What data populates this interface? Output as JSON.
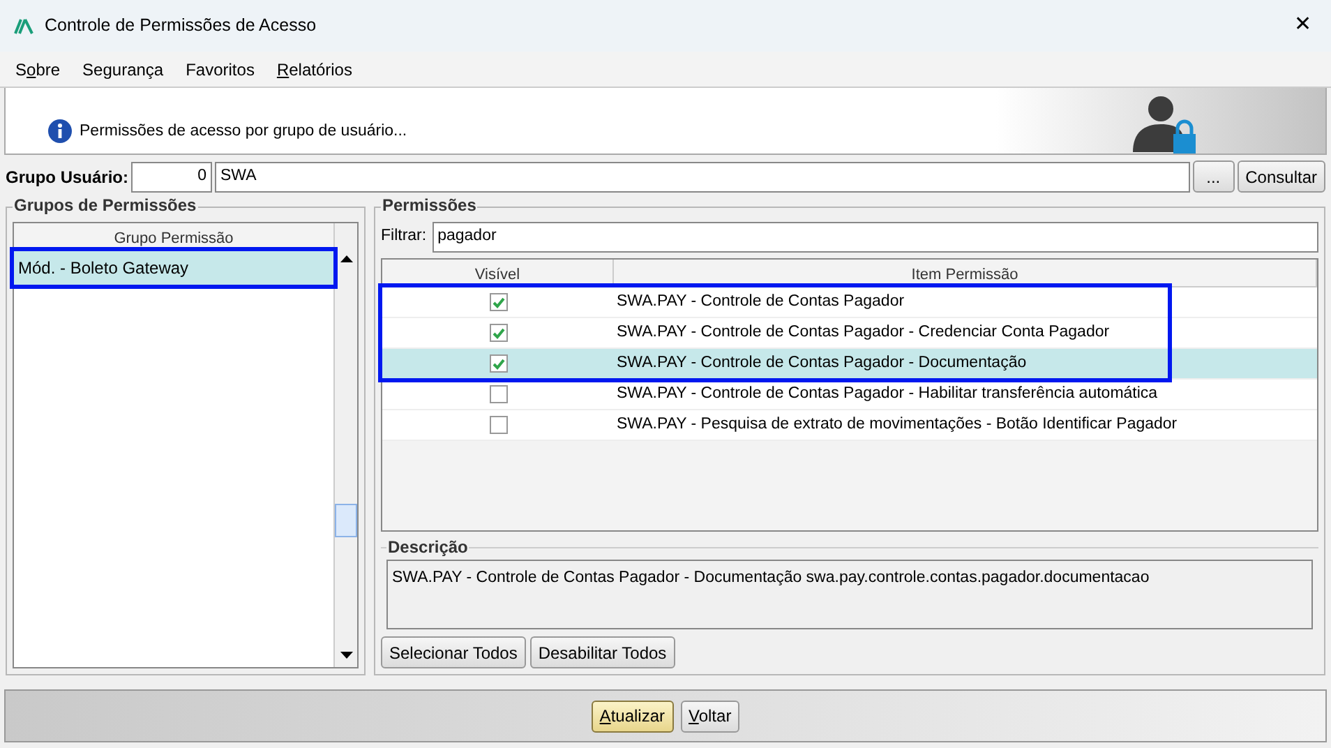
{
  "window": {
    "title": "Controle de Permissões de Acesso",
    "close": "✕"
  },
  "menu": [
    {
      "pre": "S",
      "key": "o",
      "post": "bre"
    },
    {
      "pre": "Segurança"
    },
    {
      "pre": "Favoritos"
    },
    {
      "key": "R",
      "post": "elatórios"
    }
  ],
  "banner": {
    "text": "Permissões de acesso por grupo de usuário..."
  },
  "user_group": {
    "label": "Grupo Usuário:",
    "code": "0",
    "name": "SWA",
    "browse": "...",
    "query": "Consultar"
  },
  "groups": {
    "title": "Grupos de Permissões",
    "column": "Grupo Permissão",
    "rows": [
      {
        "label": "Mód. - Boleto Gateway",
        "selected": true,
        "outlined": true
      }
    ]
  },
  "permissions": {
    "title": "Permissões",
    "filter_label": "Filtrar:",
    "filter": "pagador",
    "columns": [
      "Visível",
      "Item Permissão"
    ],
    "rows": [
      {
        "checked": true,
        "item": "SWA.PAY - Controle de Contas Pagador",
        "selected": false,
        "outlined": true
      },
      {
        "checked": true,
        "item": "SWA.PAY - Controle de Contas Pagador - Credenciar Conta Pagador",
        "selected": false,
        "outlined": true
      },
      {
        "checked": true,
        "item": "SWA.PAY - Controle de Contas Pagador - Documentação",
        "selected": true,
        "outlined": true
      },
      {
        "checked": false,
        "item": "SWA.PAY - Controle de Contas Pagador - Habilitar transferência automática",
        "selected": false,
        "outlined": false
      },
      {
        "checked": false,
        "item": "SWA.PAY - Pesquisa de extrato de movimentações - Botão Identificar Pagador",
        "selected": false,
        "outlined": false
      }
    ],
    "description_title": "Descrição",
    "description": "SWA.PAY - Controle de Contas Pagador - Documentação swa.pay.controle.contas.pagador.documentacao",
    "buttons": [
      "Selecionar Todos",
      "Desabilitar Todos"
    ]
  },
  "footer": [
    {
      "key": "A",
      "post": "tualizar",
      "default": true
    },
    {
      "key": "V",
      "post": "oltar",
      "default": false
    }
  ]
}
